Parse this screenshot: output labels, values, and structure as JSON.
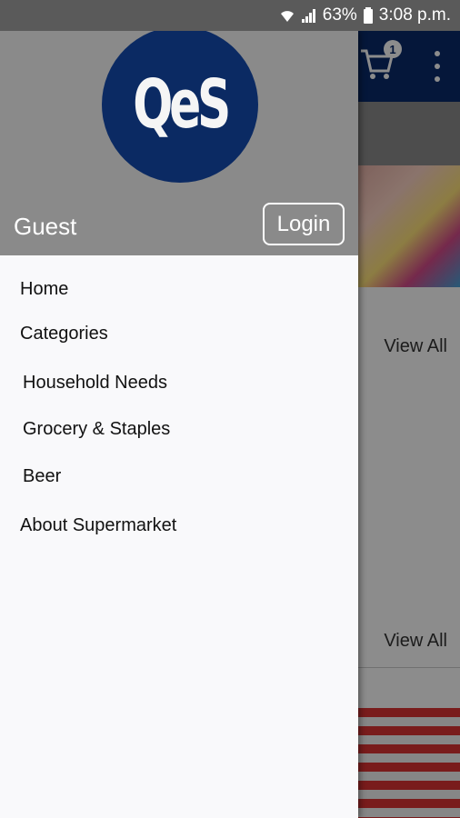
{
  "status_bar": {
    "battery": "63%",
    "time": "3:08 p.m.",
    "icons": [
      "wifi-icon",
      "signal-icon",
      "battery-icon"
    ]
  },
  "app": {
    "cart_count": "1",
    "view_all_1": "View All",
    "view_all_2": "View All"
  },
  "drawer": {
    "logo_text": "QeS",
    "user_name": "Guest",
    "login_label": "Login",
    "menu": [
      {
        "label": "Home"
      },
      {
        "label": "Categories"
      },
      {
        "label": "Household Needs"
      },
      {
        "label": "Grocery & Staples"
      },
      {
        "label": "Beer"
      },
      {
        "label": "About Supermarket"
      }
    ]
  },
  "colors": {
    "primary": "#0a2a6b",
    "logo_bg": "#0b2a63",
    "header_gray": "#8a8a8a",
    "drawer_bg": "#f9f9fb"
  }
}
